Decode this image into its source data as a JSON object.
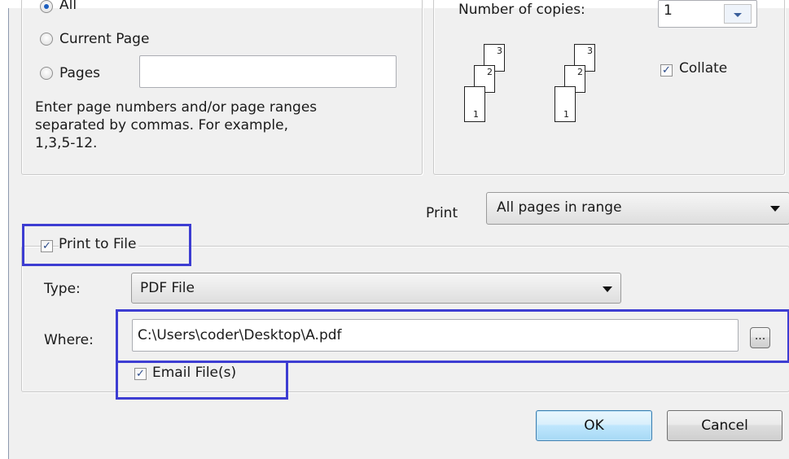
{
  "range": {
    "all_label": "All",
    "current_page_label": "Current Page",
    "pages_label": "Pages",
    "pages_value": "",
    "hint_line1": "Enter page numbers and/or page ranges",
    "hint_line2": "separated by commas.  For example,",
    "hint_line3": "1,3,5-12."
  },
  "copies": {
    "number_label": "Number of copies:",
    "number_value": "1",
    "collate_label": "Collate",
    "collate_checked": true,
    "page_numbers": [
      "3",
      "2",
      "1"
    ]
  },
  "print_select": {
    "label": "Print",
    "value": "All pages in range"
  },
  "print_to_file": {
    "label": "Print to File",
    "checked": true,
    "type_label": "Type:",
    "type_value": "PDF File",
    "where_label": "Where:",
    "where_value": "C:\\Users\\coder\\Desktop\\A.pdf",
    "browse_label": "...",
    "email_label": "Email File(s)",
    "email_checked": true
  },
  "buttons": {
    "ok_label": "OK",
    "cancel_label": "Cancel"
  },
  "colors": {
    "highlight": "#3d3dd2",
    "dialog_bg": "#f0f0f0",
    "default_button": "#a7d9f5"
  }
}
